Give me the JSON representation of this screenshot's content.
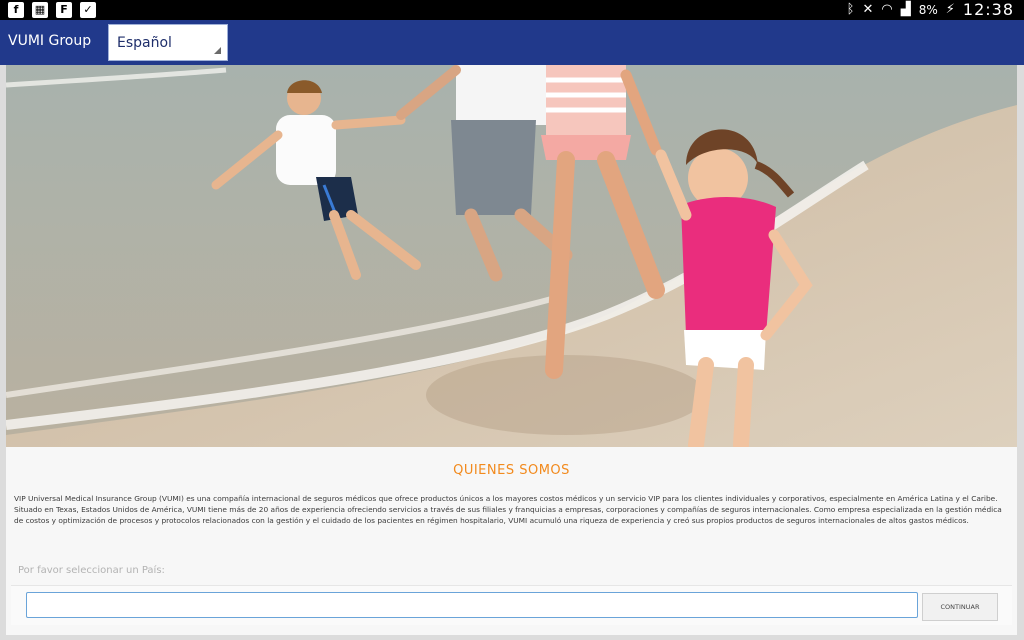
{
  "status_bar": {
    "left_icons": [
      "facebook-icon",
      "calendar-icon",
      "flipboard-icon",
      "clipboard-icon"
    ],
    "battery_percent": "8%",
    "time": "12:38"
  },
  "header": {
    "app_title": "VUMI Group",
    "language_select": {
      "selected": "Español"
    }
  },
  "about": {
    "title": "QUIENES SOMOS",
    "text": "VIP Universal Medical Insurance Group (VUMI) es una compañía internacional de seguros médicos que ofrece productos únicos a los mayores costos médicos y un servicio VIP para los clientes individuales y corporativos, especialmente en América Latina y el Caribe. Situado en Texas, Estados Unidos de América, VUMI tiene más de 20 años de experiencia ofreciendo servicios a través de sus filiales y franquicias a empresas, corporaciones y compañías de seguros internacionales. Como empresa especializada en la gestión médica de costos y optimización de procesos y protocolos relacionados con la gestión y el cuidado de los pacientes en régimen hospitalario, VUMI acumuló una riqueza de experiencia y creó sus propios productos de seguros internacionales de altos gastos médicos."
  },
  "country_form": {
    "label": "Por favor seleccionar un País:",
    "input_value": "",
    "continue_label": "CONTINUAR"
  },
  "colors": {
    "header_bg": "#21398b",
    "title_orange": "#f28a1d",
    "input_border": "#6aa4d9"
  }
}
